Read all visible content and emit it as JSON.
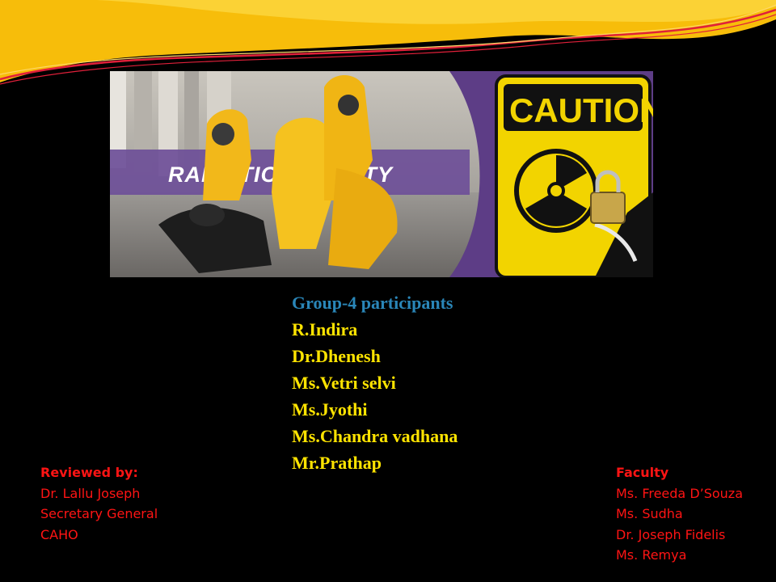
{
  "banner": {
    "title": "RADIATION SAFETY",
    "sign_text": "CAUTION"
  },
  "participants": {
    "heading": "Group-4 participants",
    "names": [
      "R.Indira",
      "Dr.Dhenesh",
      "Ms.Vetri selvi",
      "Ms.Jyothi",
      "Ms.Chandra vadhana",
      "Mr.Prathap"
    ]
  },
  "reviewed": {
    "title": "Reviewed by:",
    "lines": [
      "Dr. Lallu Joseph",
      "Secretary General",
      "CAHO"
    ]
  },
  "faculty": {
    "title": "Faculty",
    "lines": [
      "Ms. Freeda D’Souza",
      "Ms. Sudha",
      "Dr. Joseph Fidelis",
      "Ms. Remya"
    ]
  },
  "colors": {
    "background": "#000000",
    "swoosh_yellow": "#f5b400",
    "swoosh_red": "#e0203a",
    "heading_blue": "#2a86b8",
    "names_yellow": "#ffe400",
    "credits_red": "#ff1414",
    "banner_purple": "#5d3d86"
  }
}
